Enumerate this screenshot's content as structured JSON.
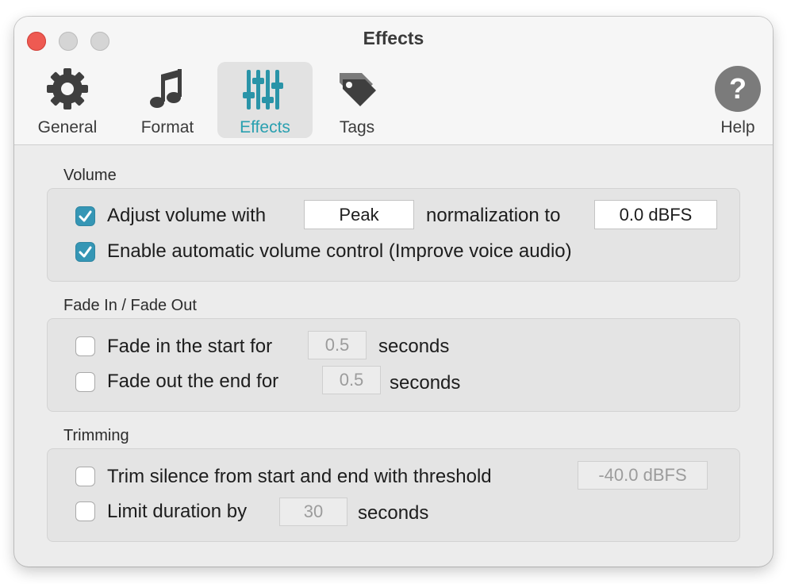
{
  "window": {
    "title": "Effects"
  },
  "toolbar": {
    "tabs": [
      {
        "label": "General",
        "icon": "gear-icon"
      },
      {
        "label": "Format",
        "icon": "music-note-icon"
      },
      {
        "label": "Effects",
        "icon": "sliders-icon",
        "selected": true
      },
      {
        "label": "Tags",
        "icon": "tag-icon"
      }
    ],
    "help": {
      "label": "Help",
      "icon": "question-icon"
    }
  },
  "volume": {
    "heading": "Volume",
    "adjust": {
      "checked": true,
      "label": "Adjust volume with",
      "mode": "Peak",
      "mid_label": "normalization to",
      "target": "0.0 dBFS"
    },
    "auto": {
      "checked": true,
      "label": "Enable automatic volume control (Improve voice audio)"
    }
  },
  "fade": {
    "heading": "Fade In / Fade Out",
    "fade_in": {
      "checked": false,
      "label": "Fade in the start for",
      "value": "0.5",
      "unit": "seconds"
    },
    "fade_out": {
      "checked": false,
      "label": "Fade out the end for",
      "value": "0.5",
      "unit": "seconds"
    }
  },
  "trimming": {
    "heading": "Trimming",
    "trim": {
      "checked": false,
      "label": "Trim silence from start and end with threshold",
      "value": "-40.0 dBFS"
    },
    "limit": {
      "checked": false,
      "label": "Limit duration by",
      "value": "30",
      "unit": "seconds"
    }
  },
  "colors": {
    "accent": "#2aa0b0",
    "checkbox_checked": "#3596b5",
    "close_button": "#ee5a52"
  }
}
